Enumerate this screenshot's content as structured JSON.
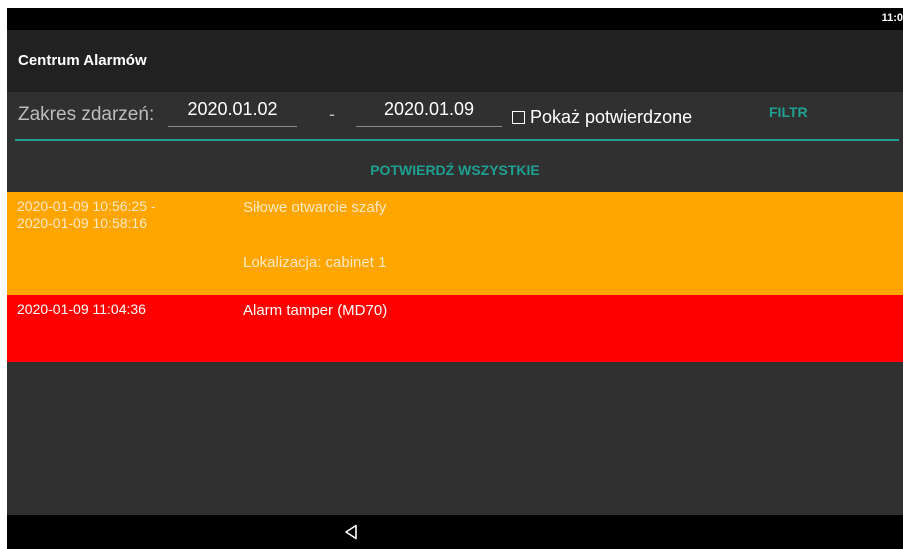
{
  "status_bar": {
    "time": "11:0"
  },
  "app_bar": {
    "title": "Centrum Alarmów"
  },
  "filter": {
    "range_label": "Zakres zdarzeń:",
    "date_from": "2020.01.02",
    "separator": "-",
    "date_to": "2020.01.09",
    "show_confirmed_label": "Pokaż potwierdzone",
    "show_confirmed_checked": false,
    "filter_button": "FILTR"
  },
  "confirm_all_button": "POTWIERDŹ WSZYSTKIE",
  "alarms": [
    {
      "time_start": "2020-01-09 10:56:25 -",
      "time_end": "2020-01-09 10:58:16",
      "text": "Siłowe otwarcie szafy",
      "location": "Lokalizacja: cabinet 1",
      "color": "#ffa500"
    },
    {
      "time_start": "2020-01-09 11:04:36",
      "text": "Alarm tamper (MD70)",
      "color": "#ff0000"
    }
  ],
  "colors": {
    "accent": "#1ea092",
    "background": "#303030",
    "app_bar": "#212121"
  },
  "nav_bar": {
    "back_icon": "back-triangle-icon"
  }
}
